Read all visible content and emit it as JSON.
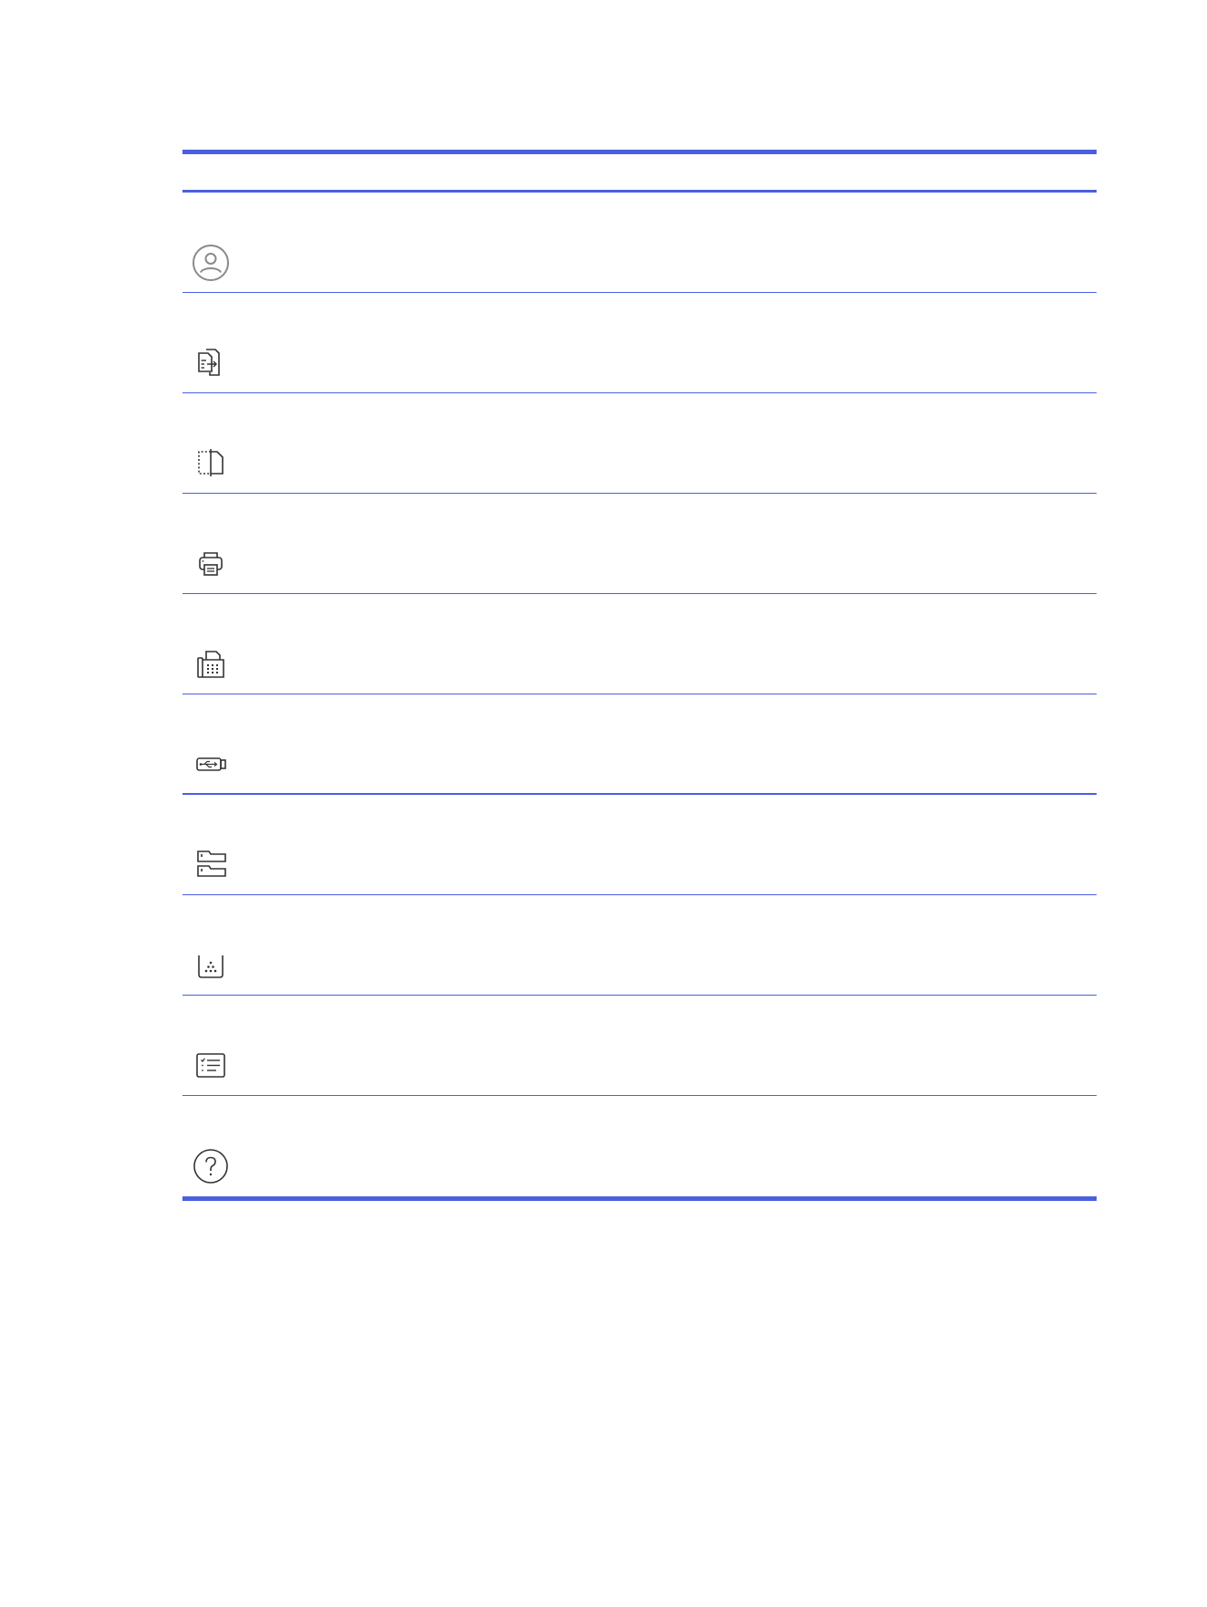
{
  "table": {
    "header": {
      "icon_col": "",
      "desc_col": ""
    },
    "rows": [
      {
        "icon": "user-circle-icon",
        "text": ""
      },
      {
        "icon": "copy-document-icon",
        "text": ""
      },
      {
        "icon": "scan-document-icon",
        "text": ""
      },
      {
        "icon": "printer-icon",
        "text": ""
      },
      {
        "icon": "fax-icon",
        "text": ""
      },
      {
        "icon": "usb-drive-icon",
        "text": ""
      },
      {
        "icon": "paper-trays-icon",
        "text": ""
      },
      {
        "icon": "toner-supplies-icon",
        "text": ""
      },
      {
        "icon": "reports-list-icon",
        "text": ""
      },
      {
        "icon": "help-question-icon",
        "text": ""
      }
    ]
  },
  "colors": {
    "rule": "#4a5fe0",
    "icon_stroke": "#333333",
    "icon_gray": "#8a8a8a"
  }
}
